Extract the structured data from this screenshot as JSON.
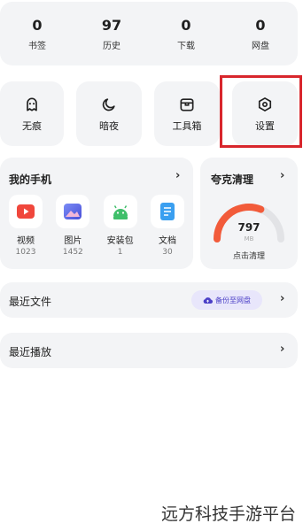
{
  "stats": [
    {
      "value": "0",
      "label": "书签"
    },
    {
      "value": "97",
      "label": "历史"
    },
    {
      "value": "0",
      "label": "下载"
    },
    {
      "value": "0",
      "label": "网盘"
    }
  ],
  "tiles": [
    {
      "label": "无痕",
      "icon": "incognito-icon"
    },
    {
      "label": "暗夜",
      "icon": "moon-icon"
    },
    {
      "label": "工具箱",
      "icon": "toolbox-icon"
    },
    {
      "label": "设置",
      "icon": "settings-icon"
    }
  ],
  "my_phone": {
    "title": "我的手机",
    "apps": [
      {
        "label": "视频",
        "count": "1023",
        "icon": "video-icon",
        "color": "#f0473c"
      },
      {
        "label": "图片",
        "count": "1452",
        "icon": "image-icon",
        "color": "#5b6cf0"
      },
      {
        "label": "安装包",
        "count": "1",
        "icon": "android-icon",
        "color": "#3fbf6a"
      },
      {
        "label": "文档",
        "count": "30",
        "icon": "document-icon",
        "color": "#3a9ff0"
      }
    ]
  },
  "cleaner": {
    "title": "夸克清理",
    "value": "797",
    "unit": "MB",
    "action": "点击清理",
    "gauge_fraction": 0.62,
    "gauge_color": "#f25b3a"
  },
  "recent_files": {
    "title": "最近文件",
    "backup_label": "备份至网盘"
  },
  "recent_play": {
    "title": "最近播放"
  },
  "watermark": "远方科技手游平台"
}
